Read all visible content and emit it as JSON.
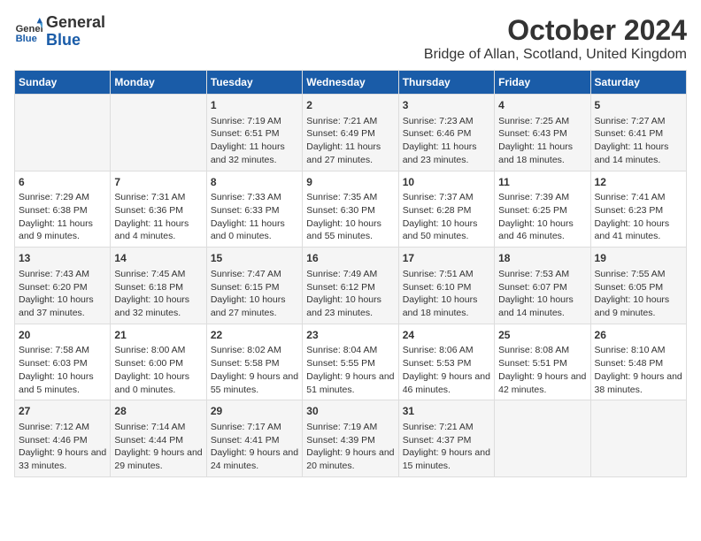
{
  "header": {
    "logo_line1": "General",
    "logo_line2": "Blue",
    "title": "October 2024",
    "subtitle": "Bridge of Allan, Scotland, United Kingdom"
  },
  "days_of_week": [
    "Sunday",
    "Monday",
    "Tuesday",
    "Wednesday",
    "Thursday",
    "Friday",
    "Saturday"
  ],
  "weeks": [
    [
      {
        "day": "",
        "info": ""
      },
      {
        "day": "",
        "info": ""
      },
      {
        "day": "1",
        "info": "Sunrise: 7:19 AM\nSunset: 6:51 PM\nDaylight: 11 hours and 32 minutes."
      },
      {
        "day": "2",
        "info": "Sunrise: 7:21 AM\nSunset: 6:49 PM\nDaylight: 11 hours and 27 minutes."
      },
      {
        "day": "3",
        "info": "Sunrise: 7:23 AM\nSunset: 6:46 PM\nDaylight: 11 hours and 23 minutes."
      },
      {
        "day": "4",
        "info": "Sunrise: 7:25 AM\nSunset: 6:43 PM\nDaylight: 11 hours and 18 minutes."
      },
      {
        "day": "5",
        "info": "Sunrise: 7:27 AM\nSunset: 6:41 PM\nDaylight: 11 hours and 14 minutes."
      }
    ],
    [
      {
        "day": "6",
        "info": "Sunrise: 7:29 AM\nSunset: 6:38 PM\nDaylight: 11 hours and 9 minutes."
      },
      {
        "day": "7",
        "info": "Sunrise: 7:31 AM\nSunset: 6:36 PM\nDaylight: 11 hours and 4 minutes."
      },
      {
        "day": "8",
        "info": "Sunrise: 7:33 AM\nSunset: 6:33 PM\nDaylight: 11 hours and 0 minutes."
      },
      {
        "day": "9",
        "info": "Sunrise: 7:35 AM\nSunset: 6:30 PM\nDaylight: 10 hours and 55 minutes."
      },
      {
        "day": "10",
        "info": "Sunrise: 7:37 AM\nSunset: 6:28 PM\nDaylight: 10 hours and 50 minutes."
      },
      {
        "day": "11",
        "info": "Sunrise: 7:39 AM\nSunset: 6:25 PM\nDaylight: 10 hours and 46 minutes."
      },
      {
        "day": "12",
        "info": "Sunrise: 7:41 AM\nSunset: 6:23 PM\nDaylight: 10 hours and 41 minutes."
      }
    ],
    [
      {
        "day": "13",
        "info": "Sunrise: 7:43 AM\nSunset: 6:20 PM\nDaylight: 10 hours and 37 minutes."
      },
      {
        "day": "14",
        "info": "Sunrise: 7:45 AM\nSunset: 6:18 PM\nDaylight: 10 hours and 32 minutes."
      },
      {
        "day": "15",
        "info": "Sunrise: 7:47 AM\nSunset: 6:15 PM\nDaylight: 10 hours and 27 minutes."
      },
      {
        "day": "16",
        "info": "Sunrise: 7:49 AM\nSunset: 6:12 PM\nDaylight: 10 hours and 23 minutes."
      },
      {
        "day": "17",
        "info": "Sunrise: 7:51 AM\nSunset: 6:10 PM\nDaylight: 10 hours and 18 minutes."
      },
      {
        "day": "18",
        "info": "Sunrise: 7:53 AM\nSunset: 6:07 PM\nDaylight: 10 hours and 14 minutes."
      },
      {
        "day": "19",
        "info": "Sunrise: 7:55 AM\nSunset: 6:05 PM\nDaylight: 10 hours and 9 minutes."
      }
    ],
    [
      {
        "day": "20",
        "info": "Sunrise: 7:58 AM\nSunset: 6:03 PM\nDaylight: 10 hours and 5 minutes."
      },
      {
        "day": "21",
        "info": "Sunrise: 8:00 AM\nSunset: 6:00 PM\nDaylight: 10 hours and 0 minutes."
      },
      {
        "day": "22",
        "info": "Sunrise: 8:02 AM\nSunset: 5:58 PM\nDaylight: 9 hours and 55 minutes."
      },
      {
        "day": "23",
        "info": "Sunrise: 8:04 AM\nSunset: 5:55 PM\nDaylight: 9 hours and 51 minutes."
      },
      {
        "day": "24",
        "info": "Sunrise: 8:06 AM\nSunset: 5:53 PM\nDaylight: 9 hours and 46 minutes."
      },
      {
        "day": "25",
        "info": "Sunrise: 8:08 AM\nSunset: 5:51 PM\nDaylight: 9 hours and 42 minutes."
      },
      {
        "day": "26",
        "info": "Sunrise: 8:10 AM\nSunset: 5:48 PM\nDaylight: 9 hours and 38 minutes."
      }
    ],
    [
      {
        "day": "27",
        "info": "Sunrise: 7:12 AM\nSunset: 4:46 PM\nDaylight: 9 hours and 33 minutes."
      },
      {
        "day": "28",
        "info": "Sunrise: 7:14 AM\nSunset: 4:44 PM\nDaylight: 9 hours and 29 minutes."
      },
      {
        "day": "29",
        "info": "Sunrise: 7:17 AM\nSunset: 4:41 PM\nDaylight: 9 hours and 24 minutes."
      },
      {
        "day": "30",
        "info": "Sunrise: 7:19 AM\nSunset: 4:39 PM\nDaylight: 9 hours and 20 minutes."
      },
      {
        "day": "31",
        "info": "Sunrise: 7:21 AM\nSunset: 4:37 PM\nDaylight: 9 hours and 15 minutes."
      },
      {
        "day": "",
        "info": ""
      },
      {
        "day": "",
        "info": ""
      }
    ]
  ]
}
